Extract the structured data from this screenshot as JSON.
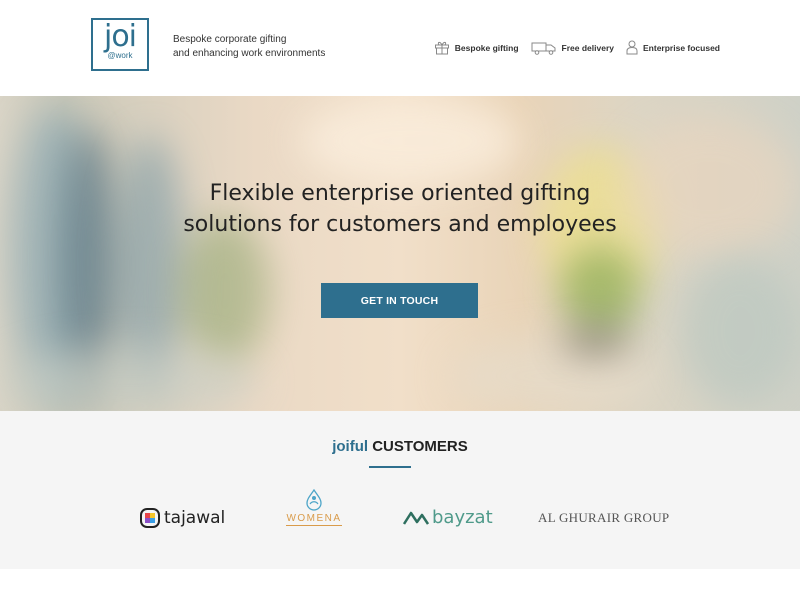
{
  "header": {
    "logo": {
      "main": "joi",
      "sub": "@work"
    },
    "tagline_line1": "Bespoke corporate gifting",
    "tagline_line2": "and enhancing work environments",
    "features": [
      {
        "icon": "gift-icon",
        "label": "Bespoke gifting"
      },
      {
        "icon": "truck-icon",
        "label": "Free delivery"
      },
      {
        "icon": "person-icon",
        "label": "Enterprise focused"
      }
    ]
  },
  "hero": {
    "title_line1": "Flexible enterprise oriented gifting",
    "title_line2": "solutions for customers and employees",
    "cta_label": "GET IN TOUCH"
  },
  "customers": {
    "title_accent": "joiful",
    "title_rest": "CUSTOMERS",
    "brands": [
      {
        "name": "tajawal"
      },
      {
        "name": "WOMENA"
      },
      {
        "name": "bayzat"
      },
      {
        "name": "AL GHURAIR GROUP"
      }
    ]
  },
  "colors": {
    "accent": "#2e6f8e",
    "section_bg": "#f5f5f5",
    "womena": "#d99b4a",
    "bayzat": "#4f9a8a"
  }
}
